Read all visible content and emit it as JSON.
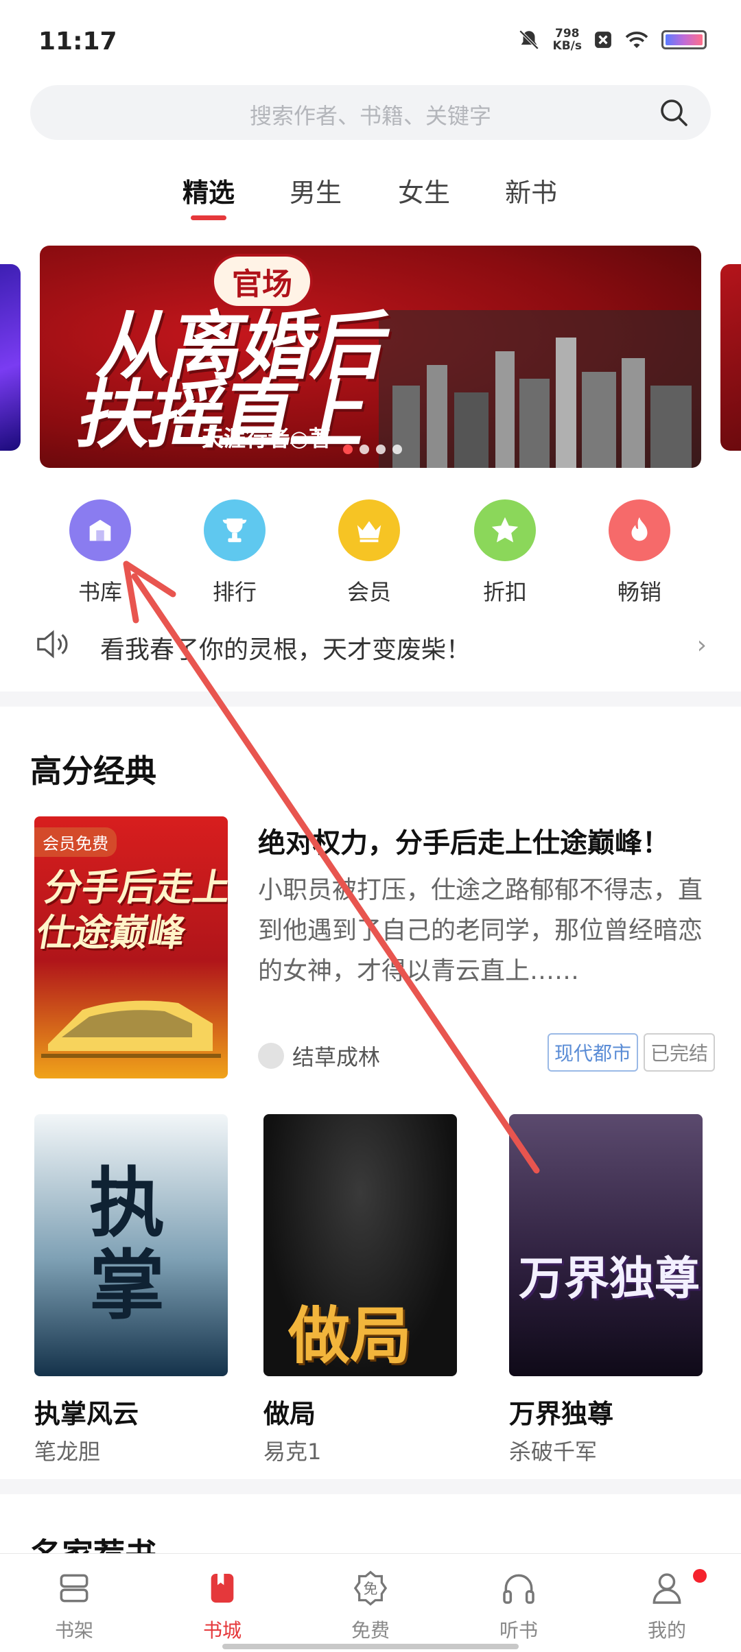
{
  "status_bar": {
    "time": "11:17",
    "speed_value": "798",
    "speed_unit": "KB/s"
  },
  "search": {
    "placeholder": "搜索作者、书籍、关键字"
  },
  "tabs": [
    {
      "label": "精选",
      "active": true
    },
    {
      "label": "男生",
      "active": false
    },
    {
      "label": "女生",
      "active": false
    },
    {
      "label": "新书",
      "active": false
    }
  ],
  "banner": {
    "badge": "官场",
    "title_line1": "从离婚后",
    "title_line2": "扶摇直上",
    "author": "天涯行者◎著",
    "slide_count": 4,
    "active_slide": 1
  },
  "entries": [
    {
      "label": "书库",
      "icon": "library-icon",
      "color": "#8a7cf0"
    },
    {
      "label": "排行",
      "icon": "trophy-icon",
      "color": "#5fc8ef"
    },
    {
      "label": "会员",
      "icon": "crown-icon",
      "color": "#f6c424"
    },
    {
      "label": "折扣",
      "icon": "star-icon",
      "color": "#8bd75a"
    },
    {
      "label": "畅销",
      "icon": "flame-icon",
      "color": "#f66a6a"
    }
  ],
  "notice": {
    "text": "看我春了你的灵根，天才变废柴！"
  },
  "section": {
    "title": "高分经典",
    "feature": {
      "cover_tag": "会员免费",
      "cover_title": "分手后走上仕途巅峰",
      "title": "绝对权力，分手后走上仕途巅峰！",
      "desc": "小职员被打压，仕途之路郁郁不得志，直到他遇到了自己的老同学，那位曾经暗恋的女神，才得以青云直上……",
      "author": "结草成林",
      "tags": [
        "现代都市",
        "已完结"
      ]
    },
    "books": [
      {
        "name": "执掌风云",
        "author": "笔龙胆",
        "cover_text": "执掌"
      },
      {
        "name": "做局",
        "author": "易克1",
        "cover_text": "做局"
      },
      {
        "name": "万界独尊",
        "author": "杀破千军",
        "cover_text": "万界独尊"
      }
    ]
  },
  "next_section": {
    "title": "名家荐书"
  },
  "bottom_nav": [
    {
      "label": "书架",
      "icon": "bookshelf-icon",
      "active": false
    },
    {
      "label": "书城",
      "icon": "bookstore-icon",
      "active": true
    },
    {
      "label": "免费",
      "icon": "free-icon",
      "active": false
    },
    {
      "label": "听书",
      "icon": "headphones-icon",
      "active": false
    },
    {
      "label": "我的",
      "icon": "profile-icon",
      "active": false
    }
  ],
  "colors": {
    "accent": "#e5383b",
    "annotation_arrow": "#e8554f"
  }
}
